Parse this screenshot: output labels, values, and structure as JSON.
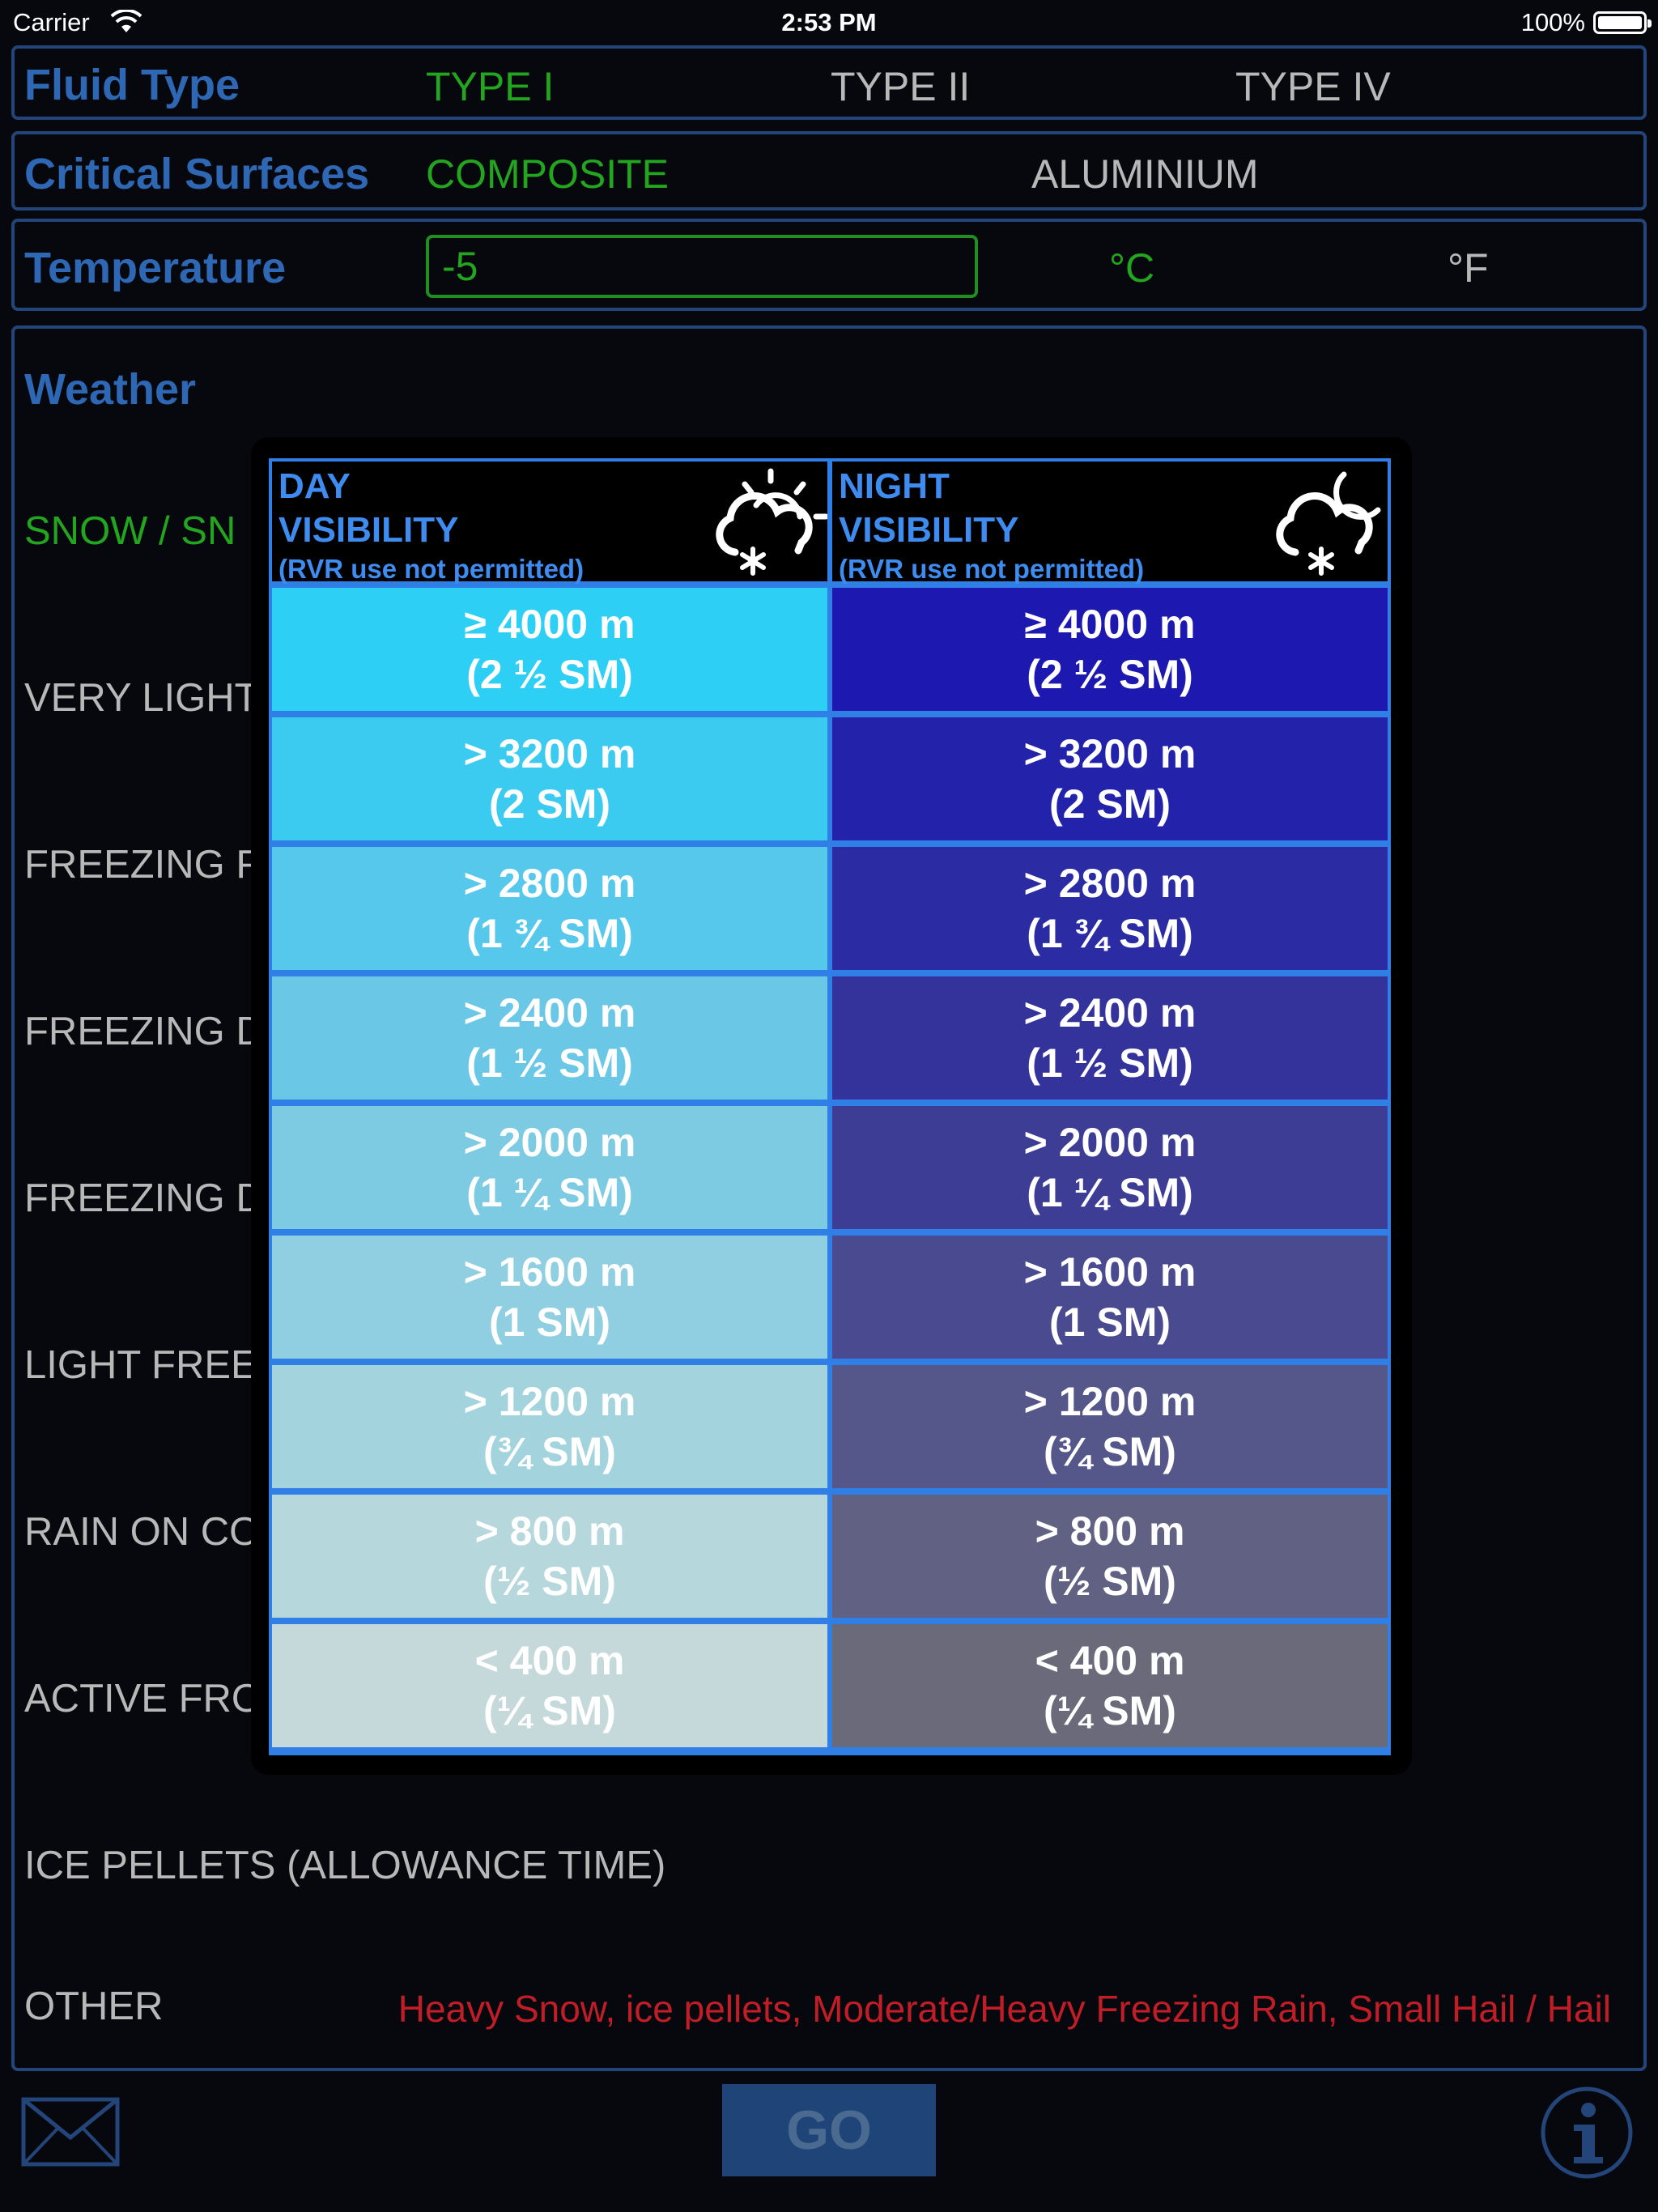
{
  "status_bar": {
    "carrier": "Carrier",
    "time": "2:53 PM",
    "battery": "100%"
  },
  "fluid_type": {
    "title": "Fluid Type",
    "options": [
      "TYPE I",
      "TYPE II",
      "TYPE IV"
    ],
    "selected": "TYPE I"
  },
  "critical_surfaces": {
    "title": "Critical Surfaces",
    "options": [
      "COMPOSITE",
      "ALUMINIUM"
    ],
    "selected": "COMPOSITE"
  },
  "temperature": {
    "title": "Temperature",
    "value": "-5",
    "units": [
      "°C",
      "°F"
    ],
    "selected_unit": "°C"
  },
  "weather": {
    "title": "Weather",
    "items": [
      "SNOW / SNOW GRAINS",
      "VERY LIGHT SNOW",
      "FREEZING FOG",
      "FREEZING DRIZZLE",
      "FREEZING DRIZZLE",
      "LIGHT FREEZING RAIN",
      "RAIN ON COLD SOAKED WING",
      "ACTIVE FROST",
      "ICE PELLETS (ALLOWANCE TIME)",
      "OTHER"
    ],
    "visible_labels": [
      "SNOW / SN",
      "VERY LIGHT",
      "FREEZING F",
      "FREEZING D",
      "FREEZING D",
      "LIGHT FREE",
      "RAIN ON CO",
      "ACTIVE FRO",
      "ICE PELLETS (ALLOWANCE TIME)",
      "OTHER"
    ],
    "selected_index": 0,
    "other_note": "Heavy Snow, ice pellets, Moderate/Heavy Freezing Rain, Small Hail / Hail"
  },
  "bottom": {
    "go_label": "GO",
    "mail_icon": "envelope-icon",
    "info_icon": "info-circle-icon"
  },
  "visibility_popup": {
    "day": {
      "line1": "DAY",
      "line2": "VISIBILITY",
      "note": "(RVR use not permitted)",
      "icon": "sun-cloud-snow-icon",
      "rows": [
        {
          "m": "≥ 4000 m",
          "sm": "(2 ½ SM)"
        },
        {
          "m": "> 3200 m",
          "sm": "(2 SM)"
        },
        {
          "m": "> 2800 m",
          "sm": "(1 ¾ SM)"
        },
        {
          "m": "> 2400 m",
          "sm": "(1 ½ SM)"
        },
        {
          "m": "> 2000 m",
          "sm": "(1 ¼ SM)"
        },
        {
          "m": "> 1600 m",
          "sm": "(1 SM)"
        },
        {
          "m": "> 1200 m",
          "sm": "(¾ SM)"
        },
        {
          "m": "> 800 m",
          "sm": "(½ SM)"
        },
        {
          "m": "< 400 m",
          "sm": "(¼ SM)"
        }
      ],
      "colors": [
        "#2ecff4",
        "#3ccbf0",
        "#55c8ec",
        "#6ac8e6",
        "#7ccbe3",
        "#8fcfe1",
        "#a3d4dd",
        "#b6d8dc",
        "#c6d9da"
      ]
    },
    "night": {
      "line1": "NIGHT",
      "line2": "VISIBILITY",
      "note": "(RVR use not permitted)",
      "icon": "moon-cloud-snow-icon",
      "rows": [
        {
          "m": "≥ 4000 m",
          "sm": "(2 ½ SM)"
        },
        {
          "m": "> 3200 m",
          "sm": "(2 SM)"
        },
        {
          "m": "> 2800 m",
          "sm": "(1 ¾ SM)"
        },
        {
          "m": "> 2400 m",
          "sm": "(1 ½ SM)"
        },
        {
          "m": "> 2000 m",
          "sm": "(1 ¼ SM)"
        },
        {
          "m": "> 1600 m",
          "sm": "(1 SM)"
        },
        {
          "m": "> 1200 m",
          "sm": "(¾ SM)"
        },
        {
          "m": "> 800 m",
          "sm": "(½ SM)"
        },
        {
          "m": "< 400 m",
          "sm": "(¼ SM)"
        }
      ],
      "colors": [
        "#1d19b0",
        "#2322aa",
        "#2b2ca3",
        "#33339b",
        "#3d3d95",
        "#4a4a90",
        "#55568a",
        "#606183",
        "#6a6a7a"
      ]
    }
  },
  "colors": {
    "accent_blue": "#2e67b3",
    "selected_green": "#23a51f",
    "warning_red": "#c01d27",
    "panel_border": "#24457a"
  }
}
